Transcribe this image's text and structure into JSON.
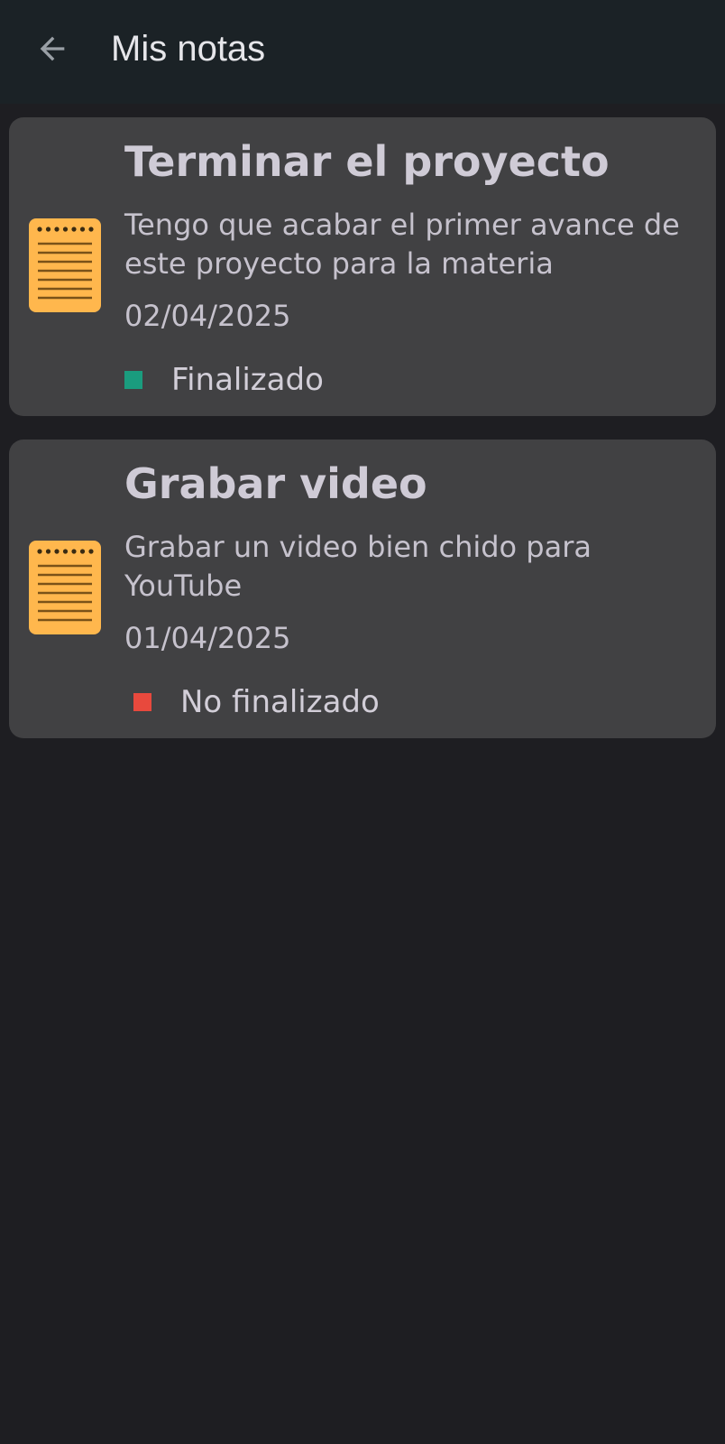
{
  "appbar": {
    "back_icon": "arrow-left-icon",
    "title": "Mis notas"
  },
  "notes": [
    {
      "icon": "notepad-icon",
      "title": "Terminar el proyecto",
      "description": "Tengo que acabar el primer avance de este proyecto para la materia",
      "date": "02/04/2025",
      "status": "Finalizado",
      "status_color": "#1a9c7e"
    },
    {
      "icon": "notepad-icon",
      "title": "Grabar video",
      "description": "Grabar un video bien chido para YouTube",
      "date": "01/04/2025",
      "status": "No finalizado",
      "status_color": "#e8493d"
    }
  ],
  "colors": {
    "background": "#1e1e22",
    "appbar": "#1b2226",
    "card": "#414143",
    "icon_accent": "#ffb74d"
  }
}
